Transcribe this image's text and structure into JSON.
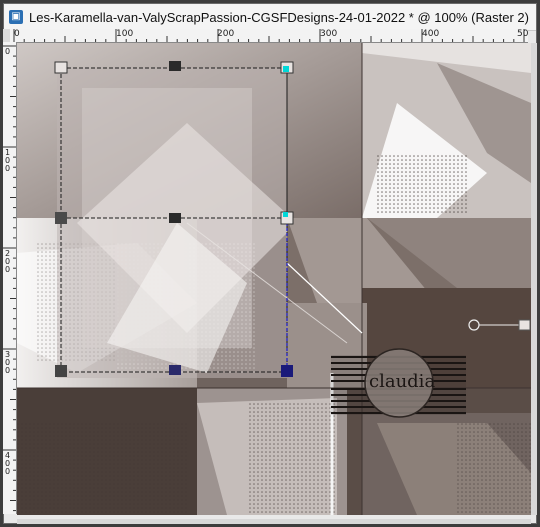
{
  "window": {
    "title": "Les-Karamella-van-ValyScrapPassion-CGSFDesigns-24-01-2022 * @ 100% (Raster 2)",
    "app_icon": "psp-icon"
  },
  "rulers": {
    "top_labels": [
      "0",
      "100",
      "200",
      "300",
      "400",
      "50"
    ],
    "left_labels": [
      "0",
      "1\n0\n0",
      "2\n0\n0",
      "3\n0\n0",
      "4\n0\n0"
    ]
  },
  "canvas": {
    "watermark_text": "claudia",
    "colors": {
      "dark": "#4e433f",
      "mid": "#8a7e79",
      "light": "#d9d4d2",
      "accent": "#00e5e5"
    }
  }
}
